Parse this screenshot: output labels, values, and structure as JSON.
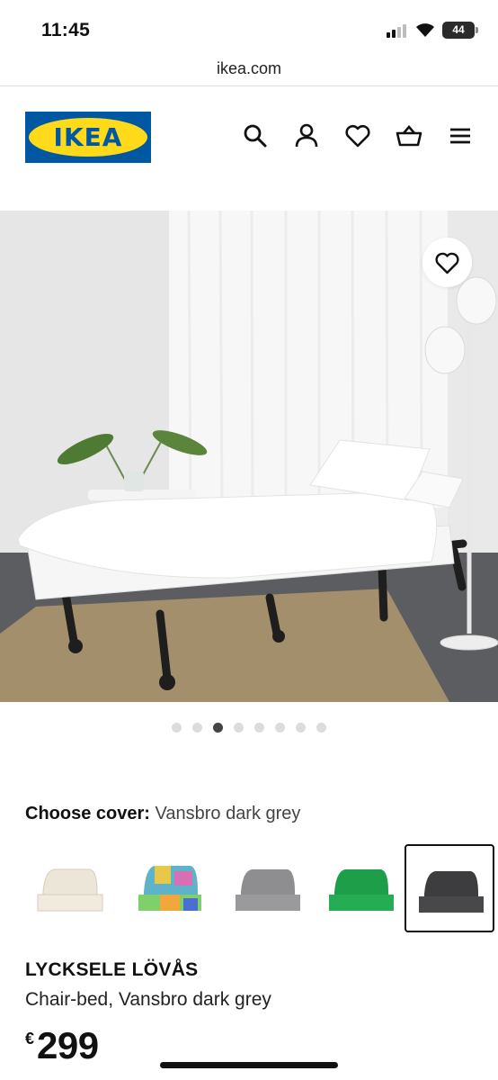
{
  "status_bar": {
    "time": "11:45",
    "battery": "44"
  },
  "browser": {
    "url": "ikea.com"
  },
  "header": {
    "logo_text": "IKEA",
    "icons": [
      "search-icon",
      "account-icon",
      "heart-icon",
      "shopping-bag-icon",
      "menu-icon"
    ]
  },
  "gallery": {
    "image_count": 8,
    "active_index": 2,
    "favourite_icon": "heart-icon"
  },
  "cover": {
    "label": "Choose cover:",
    "selected": "Vansbro dark grey",
    "options": [
      {
        "color": "#ece6d8"
      },
      {
        "color": "#5fb3c8"
      },
      {
        "color": "#8e8e90"
      },
      {
        "color": "#1f9e4a"
      },
      {
        "color": "#3d3d3f"
      }
    ],
    "selected_index": 4
  },
  "product": {
    "name": "LYCKSELE LÖVÅS",
    "description": "Chair-bed, Vansbro dark grey",
    "currency": "€",
    "price": "299"
  },
  "colors": {
    "brand_blue": "#0058a3",
    "brand_yellow": "#ffda1a"
  }
}
